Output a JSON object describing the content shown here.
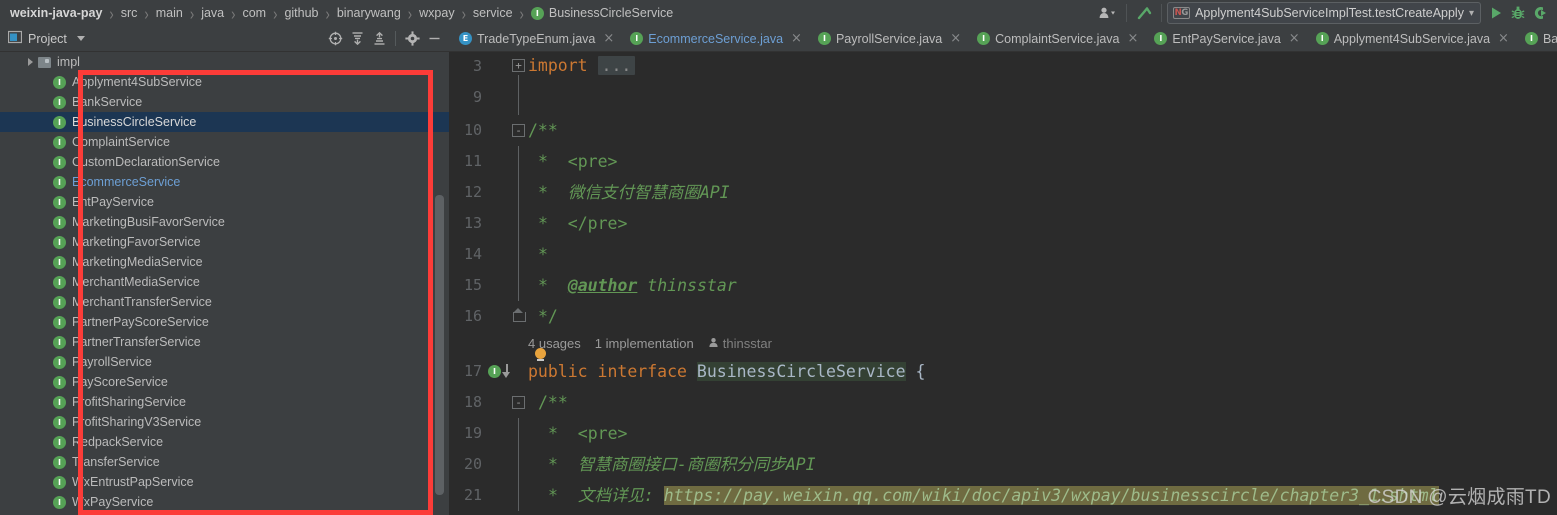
{
  "navbar": {
    "breadcrumb": [
      {
        "label": "weixin-java-pay",
        "root": true
      },
      {
        "label": "src"
      },
      {
        "label": "main"
      },
      {
        "label": "java"
      },
      {
        "label": "com"
      },
      {
        "label": "github"
      },
      {
        "label": "binarywang"
      },
      {
        "label": "wxpay"
      },
      {
        "label": "service"
      },
      {
        "label": "BusinessCircleService",
        "icon": "interface-icon"
      }
    ],
    "separator": "›",
    "user_icon": "user-chevron-icon",
    "build_icon": "hammer-icon",
    "run_config": {
      "icon_n": "N",
      "icon_g": "G",
      "label": "Applyment4SubServiceImplTest.testCreateApply",
      "chevron": "▾"
    },
    "run_icon": "run-icon",
    "debug_icon": "debug-icon",
    "coverage_icon": "run-with-coverage-icon"
  },
  "project_panel": {
    "title": "Project",
    "chevron": "▾",
    "icons": [
      {
        "name": "select-opened-file-icon"
      },
      {
        "name": "expand-all-icon"
      },
      {
        "name": "collapse-all-icon"
      },
      {
        "name": "settings-gear-icon"
      },
      {
        "name": "hide-panel-icon"
      }
    ],
    "tree": [
      {
        "label": "impl",
        "type": "folder",
        "depth": 1,
        "expandable": true
      },
      {
        "label": "Applyment4SubService",
        "type": "interface",
        "depth": 2
      },
      {
        "label": "BankService",
        "type": "interface",
        "depth": 2
      },
      {
        "label": "BusinessCircleService",
        "type": "interface",
        "depth": 2,
        "state": "selected"
      },
      {
        "label": "ComplaintService",
        "type": "interface",
        "depth": 2
      },
      {
        "label": "CustomDeclarationService",
        "type": "interface",
        "depth": 2
      },
      {
        "label": "EcommerceService",
        "type": "interface",
        "depth": 2,
        "state": "opened"
      },
      {
        "label": "EntPayService",
        "type": "interface",
        "depth": 2
      },
      {
        "label": "MarketingBusiFavorService",
        "type": "interface",
        "depth": 2
      },
      {
        "label": "MarketingFavorService",
        "type": "interface",
        "depth": 2
      },
      {
        "label": "MarketingMediaService",
        "type": "interface",
        "depth": 2
      },
      {
        "label": "MerchantMediaService",
        "type": "interface",
        "depth": 2
      },
      {
        "label": "MerchantTransferService",
        "type": "interface",
        "depth": 2
      },
      {
        "label": "PartnerPayScoreService",
        "type": "interface",
        "depth": 2
      },
      {
        "label": "PartnerTransferService",
        "type": "interface",
        "depth": 2
      },
      {
        "label": "PayrollService",
        "type": "interface",
        "depth": 2
      },
      {
        "label": "PayScoreService",
        "type": "interface",
        "depth": 2
      },
      {
        "label": "ProfitSharingService",
        "type": "interface",
        "depth": 2
      },
      {
        "label": "ProfitSharingV3Service",
        "type": "interface",
        "depth": 2
      },
      {
        "label": "RedpackService",
        "type": "interface",
        "depth": 2
      },
      {
        "label": "TransferService",
        "type": "interface",
        "depth": 2
      },
      {
        "label": "WxEntrustPapService",
        "type": "interface",
        "depth": 2
      },
      {
        "label": "WxPayService",
        "type": "interface",
        "depth": 2
      }
    ]
  },
  "editor_tabs": [
    {
      "label": "TradeTypeEnum.java",
      "icon": "enum-icon",
      "active": false,
      "close": "×"
    },
    {
      "label": "EcommerceService.java",
      "icon": "interface-icon",
      "active": true,
      "close": "×"
    },
    {
      "label": "PayrollService.java",
      "icon": "interface-icon",
      "active": false,
      "close": "×"
    },
    {
      "label": "ComplaintService.java",
      "icon": "interface-icon",
      "active": false,
      "close": "×"
    },
    {
      "label": "EntPayService.java",
      "icon": "interface-icon",
      "active": false,
      "close": "×"
    },
    {
      "label": "Applyment4SubService.java",
      "icon": "interface-icon",
      "active": false,
      "close": "×"
    },
    {
      "label": "BankService.java",
      "icon": "interface-icon",
      "active": false,
      "close": "×"
    }
  ],
  "code": {
    "lines": [
      {
        "no": "3",
        "fold": "+"
      },
      {
        "no": "9"
      },
      {
        "no": "10",
        "fold": "-"
      },
      {
        "no": "11"
      },
      {
        "no": "12"
      },
      {
        "no": "13"
      },
      {
        "no": "14"
      },
      {
        "no": "15"
      },
      {
        "no": "16",
        "fold": "end"
      },
      {
        "no": "17",
        "gutter": "interface-implemented-icon"
      },
      {
        "no": "18",
        "fold": "-"
      },
      {
        "no": "19"
      },
      {
        "no": "20"
      },
      {
        "no": "21"
      }
    ],
    "text": {
      "l3_kw": "import",
      "l3_ellipsis": "...",
      "l10": "/**",
      "l11": "*  <pre>",
      "l12_star": "*  ",
      "l12_cmt": "微信支付智慧商圈API",
      "l13": "*  </pre>",
      "l14": "*",
      "l15_star": "*  ",
      "l15_tag": "@author",
      "l15_val": " thinsstar",
      "l16": "*/",
      "l17_kw1": "public",
      "l17_kw2": "interface",
      "l17_name": "BusinessCircleService",
      "l17_brace": " {",
      "l18": "/**",
      "l19": "*  <pre>",
      "l20_star": "*  ",
      "l20_cmt": "智慧商圈接口-商圈积分同步API",
      "l21_star": "*  ",
      "l21_cmt": "文档详见: ",
      "l21_url": "https://pay.weixin.qq.com/wiki/doc/apiv3/wxpay/businesscircle/chapter3_1.shtml"
    },
    "code_vision": {
      "usages": "4 usages",
      "implementations": "1 implementation",
      "author_icon": "person-icon",
      "author": "thinsstar",
      "bulb_icon": "intention-bulb-icon"
    }
  },
  "annotation": {
    "box_color": "#fc3c38",
    "name": "red-highlight-rectangle"
  },
  "watermark": "CSDN @云烟成雨TD"
}
